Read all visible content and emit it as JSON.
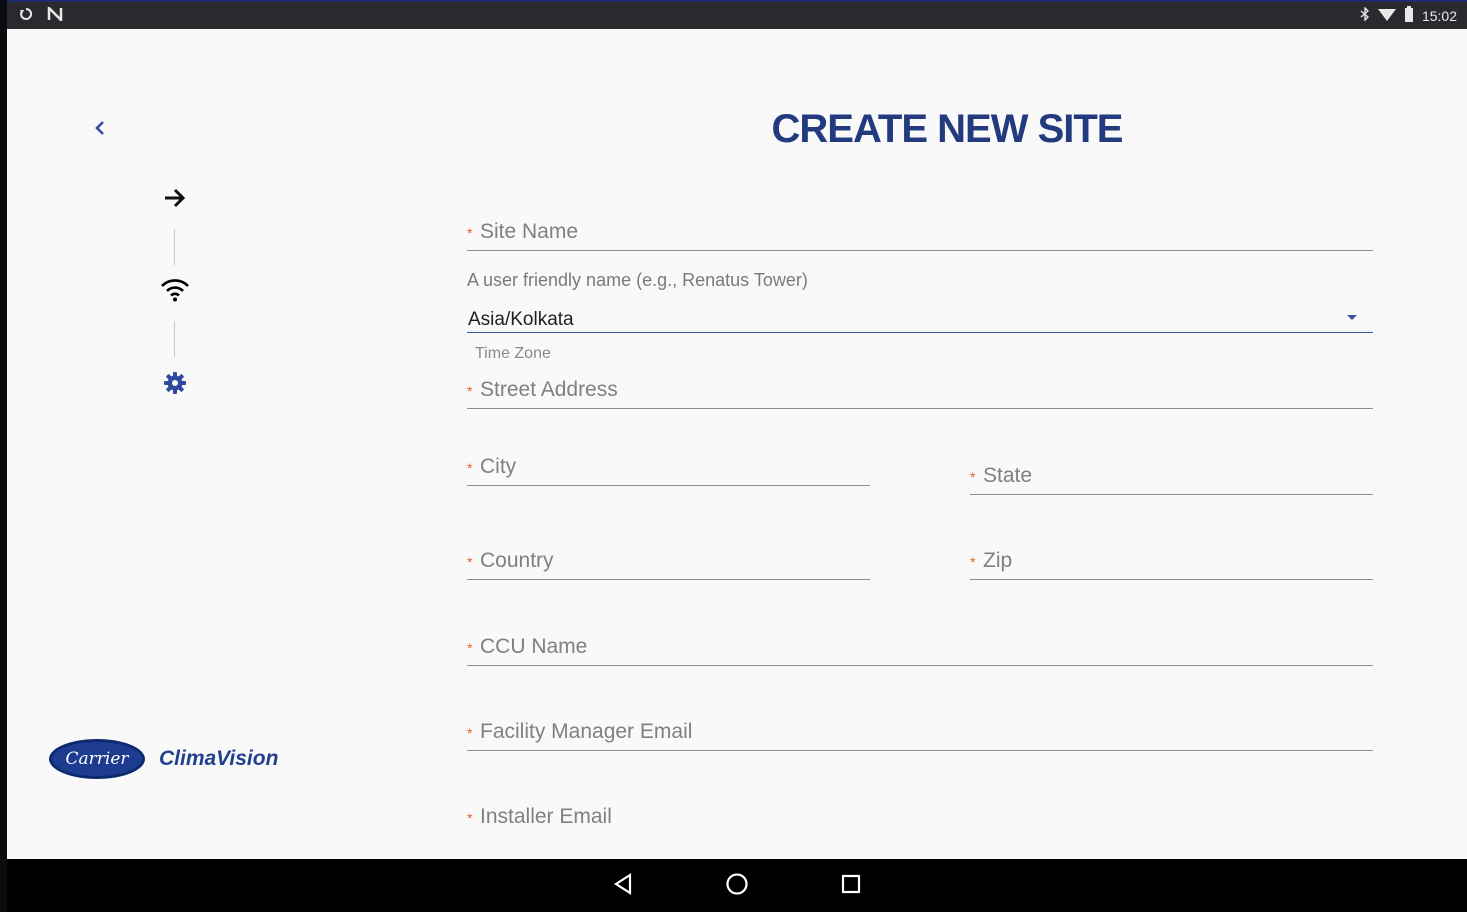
{
  "status_bar": {
    "left_icons": [
      "sync-icon",
      "nfc-icon"
    ],
    "right_icons": [
      "bluetooth-icon",
      "wifi-signal-icon",
      "battery-icon"
    ],
    "time": "15:02"
  },
  "header": {
    "title": "CREATE NEW SITE",
    "back_icon": "chevron-left-icon"
  },
  "stepper": {
    "steps": [
      {
        "icon": "arrow-right-icon",
        "state": "current"
      },
      {
        "icon": "wifi-icon",
        "state": "pending"
      },
      {
        "icon": "gear-icon",
        "state": "pending"
      }
    ],
    "colors": {
      "current": "#111111",
      "pending": "#000000",
      "settings": "#2f4aa0"
    }
  },
  "form": {
    "required_mark": "*",
    "site_name": {
      "placeholder": "Site Name",
      "helper": "A user friendly name (e.g., Renatus Tower)"
    },
    "time_zone": {
      "value": "Asia/Kolkata",
      "label": "Time Zone"
    },
    "street_address": {
      "placeholder": "Street Address"
    },
    "city": {
      "placeholder": "City"
    },
    "state": {
      "placeholder": "State"
    },
    "country": {
      "placeholder": "Country"
    },
    "zip": {
      "placeholder": "Zip"
    },
    "ccu_name": {
      "placeholder": "CCU Name"
    },
    "facility_manager_email": {
      "placeholder": "Facility Manager Email"
    },
    "installer_email": {
      "placeholder": "Installer Email"
    }
  },
  "branding": {
    "carrier_logo_text": "Carrier",
    "product_name": "ClimaVision"
  },
  "nav_bar": {
    "buttons": [
      "back-triangle-icon",
      "home-circle-icon",
      "recents-square-icon"
    ]
  },
  "colors": {
    "accent": "#243a7f",
    "required_star": "#e8612c",
    "background": "#f9f9fa"
  }
}
